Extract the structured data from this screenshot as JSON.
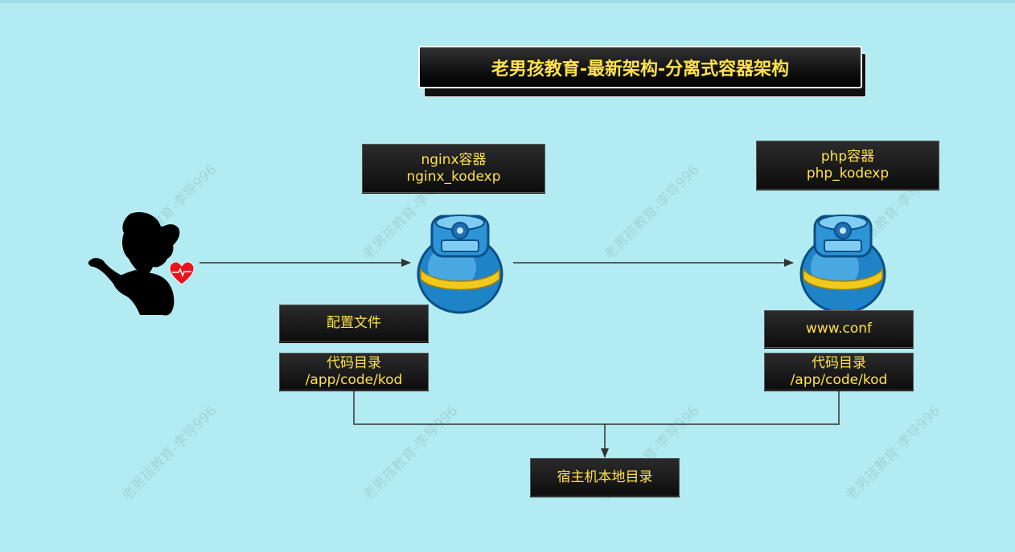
{
  "title": "老男孩教育-最新架构-分离式容器架构",
  "nginx_box": {
    "line1": "nginx容器",
    "line2": "nginx_kodexp"
  },
  "php_box": {
    "line1": "php容器",
    "line2": "php_kodexp"
  },
  "config_box": {
    "label": "配置文件"
  },
  "nginx_code_box": {
    "line1": "代码目录",
    "line2": "/app/code/kod"
  },
  "www_conf_box": {
    "label": "www.conf"
  },
  "php_code_box": {
    "line1": "代码目录",
    "line2": "/app/code/kod"
  },
  "host_box": {
    "label": "宿主机本地目录"
  },
  "watermark": "老男孩教育-李导996",
  "colors": {
    "background": "#b3ebf2",
    "box_text": "#ffe24a",
    "box_fill": "#111111",
    "connector": "#333333"
  },
  "icons": {
    "user": "woman-silhouette-icon",
    "heart": "heart-icon",
    "container": "blue-canister-icon"
  }
}
